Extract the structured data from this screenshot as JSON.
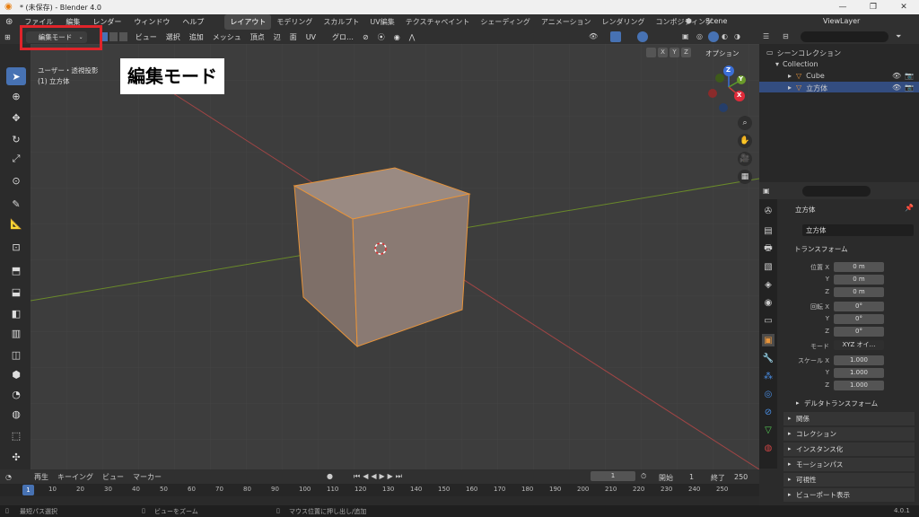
{
  "window": {
    "title": "* (未保存) - Blender 4.0",
    "minimize": "—",
    "maximize": "❐",
    "close": "✕"
  },
  "menu": [
    "ファイル",
    "編集",
    "レンダー",
    "ウィンドウ",
    "ヘルプ"
  ],
  "workspaces": [
    "レイアウト",
    "モデリング",
    "スカルプト",
    "UV編集",
    "テクスチャペイント",
    "シェーディング",
    "アニメーション",
    "レンダリング",
    "コンポジティング"
  ],
  "scene": "Scene",
  "view_layer": "ViewLayer",
  "header": {
    "mode": "編集モード",
    "items": [
      "ビュー",
      "選択",
      "追加",
      "メッシュ",
      "頂点",
      "辺",
      "面",
      "UV"
    ],
    "transform": "グロ…",
    "options": "オプション",
    "axes": [
      "X",
      "Y",
      "Z"
    ]
  },
  "viewport": {
    "view_name": "ユーザー・透視投影",
    "object_line": "(1) 立方体",
    "callout": "編集モード",
    "gizmo": {
      "x": "X",
      "y": "Y",
      "z": "Z"
    }
  },
  "outliner": {
    "root": "シーンコレクション",
    "collection": "Collection",
    "items": [
      "Cube",
      "立方体"
    ]
  },
  "props": {
    "object_name": "立方体",
    "data_name": "立方体",
    "transform_title": "トランスフォーム",
    "location_label": "位置 X",
    "rotation_label": "回転 X",
    "scale_label": "スケール X",
    "mode_label": "モード",
    "location": [
      "0 m",
      "0 m",
      "0 m"
    ],
    "rotation": [
      "0°",
      "0°",
      "0°"
    ],
    "mode": "XYZ オイ…",
    "scale": [
      "1.000",
      "1.000",
      "1.000"
    ],
    "delta": "デルタトランスフォーム",
    "sections": [
      "関係",
      "コレクション",
      "インスタンス化",
      "モーションパス",
      "可視性",
      "ビューポート表示"
    ]
  },
  "timeline": {
    "play": "再生",
    "keying": "キーイング",
    "view": "ビュー",
    "marker": "マーカー",
    "current_frame": "1",
    "start_label": "開始",
    "start": "1",
    "end_label": "終了",
    "end": "250",
    "ticks": [
      "1",
      "10",
      "20",
      "30",
      "40",
      "50",
      "60",
      "70",
      "80",
      "90",
      "100",
      "110",
      "120",
      "130",
      "140",
      "150",
      "160",
      "170",
      "180",
      "190",
      "200",
      "210",
      "220",
      "230",
      "240",
      "250"
    ]
  },
  "status": {
    "left": "最短パス選択",
    "mid": "ビューをズーム",
    "right": "マウス位置に押し出し/追加",
    "version": "4.0.1"
  },
  "colors": {
    "accent": "#4772b3",
    "callout_border": "#e0242a",
    "mesh_edge": "#e8943a",
    "axis_x": "#c84a4a",
    "axis_y": "#6a8a2a"
  }
}
